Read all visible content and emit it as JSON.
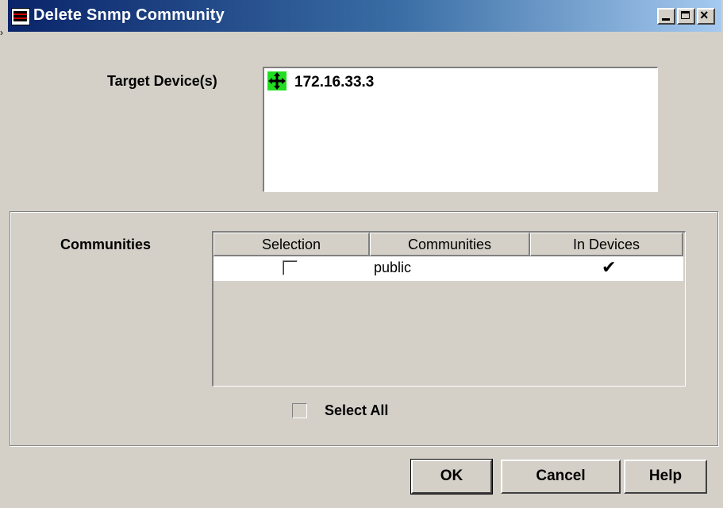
{
  "window": {
    "title": "Delete Snmp Community",
    "controls": [
      "minimize",
      "maximize",
      "close"
    ],
    "close_glyph": "×"
  },
  "target": {
    "label": "Target Device(s)",
    "devices": [
      {
        "icon": "network-device-icon",
        "ip": "172.16.33.3"
      }
    ]
  },
  "communities": {
    "label": "Communities",
    "columns": [
      "Selection",
      "Communities",
      "In Devices"
    ],
    "rows": [
      {
        "selected": false,
        "name": "public",
        "in_devices": "✔"
      }
    ],
    "select_all_label": "Select All",
    "select_all_checked": false
  },
  "buttons": {
    "ok": "OK",
    "cancel": "Cancel",
    "help": "Help"
  },
  "colors": {
    "title_start": "#0a246a",
    "title_end": "#a6caf0",
    "dialog_bg": "#d4d0c8",
    "device_icon_bg": "#22dd22"
  }
}
